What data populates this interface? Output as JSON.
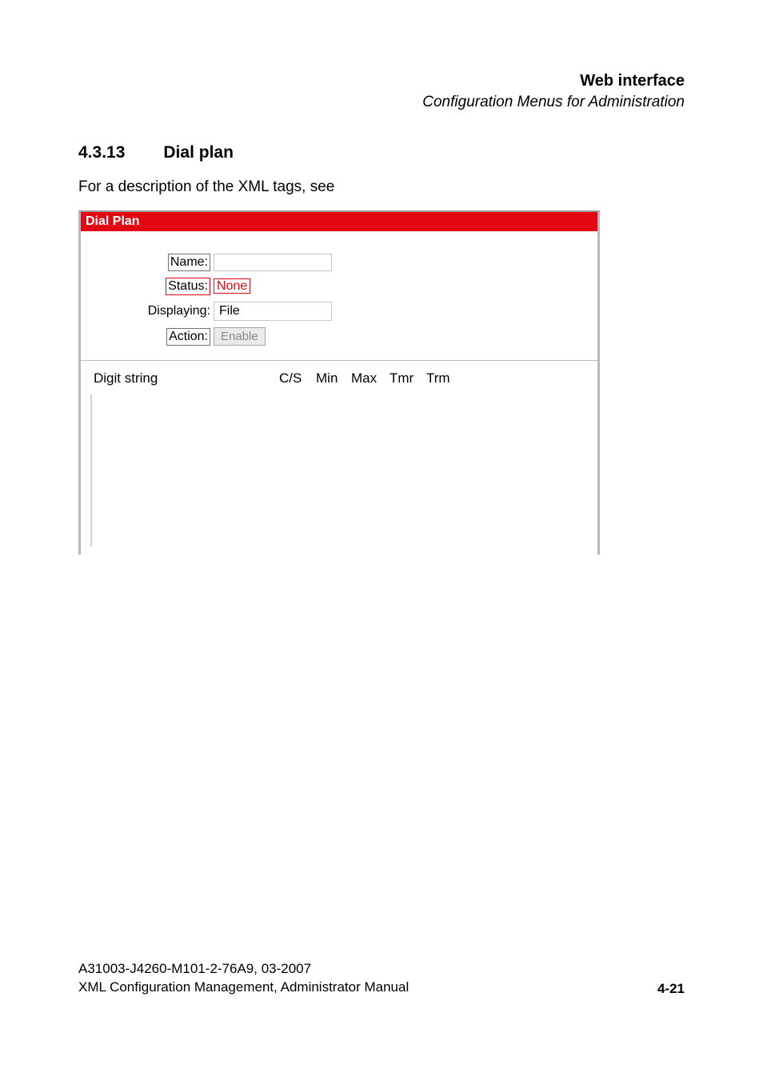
{
  "header": {
    "title": "Web interface",
    "subtitle": "Configuration Menus for Administration"
  },
  "section": {
    "number": "4.3.13",
    "title": "Dial plan"
  },
  "intro": "For a description of the XML tags, see",
  "panel": {
    "title": "Dial Plan",
    "fields": {
      "name_label": "Name:",
      "name_value": "",
      "status_label": "Status:",
      "status_value": "None",
      "displaying_label": "Displaying:",
      "displaying_value": "File",
      "action_label": "Action:",
      "action_button": "Enable"
    },
    "columns": {
      "digit": "Digit string",
      "cs": "C/S",
      "min": "Min",
      "max": "Max",
      "tmr": "Tmr",
      "trm": "Trm"
    }
  },
  "footer": {
    "line1": "A31003-J4260-M101-2-76A9, 03-2007",
    "line2": "XML Configuration Management, Administrator Manual",
    "page": "4-21"
  }
}
